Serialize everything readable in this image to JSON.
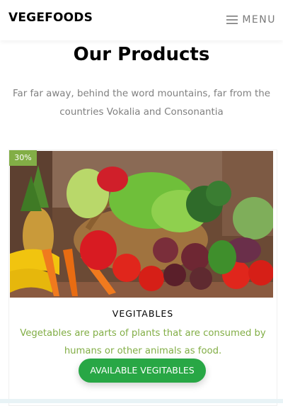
{
  "navbar": {
    "brand": "VEGEFOODS",
    "menu_label": "MENU",
    "menu_icon": "hamburger-icon"
  },
  "section": {
    "title": "Our Products",
    "subtitle": "Far far away, behind the word mountains, far from the countries Vokalia and Consonantia"
  },
  "product": {
    "badge": "30%",
    "name": "VEGITABLES",
    "description": "Vegetables are parts of plants that are consumed by humans or other animals as food.",
    "button_label": "AVAILABLE VEGITABLES"
  },
  "colors": {
    "accent_green": "#82ae46",
    "button_green": "#28a745"
  }
}
